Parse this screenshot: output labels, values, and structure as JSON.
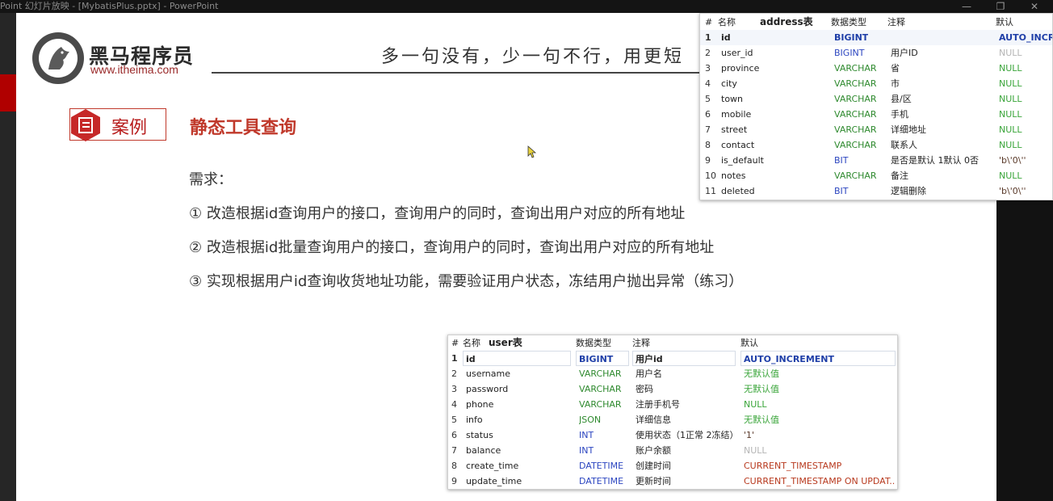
{
  "window": {
    "title": "Point 幻灯片放映 - [MybatisPlus.pptx] - PowerPoint",
    "buttons": [
      "—",
      "❐",
      "✕"
    ]
  },
  "slide": {
    "logo_text": "黑马程序员",
    "logo_url": "www.itheima.com",
    "slogan": "多一句没有，少一句不行，用更短",
    "case_label": "案例",
    "title": "静态工具查询",
    "requirements_title": "需求：",
    "requirements": [
      "①  改造根据id查询用户的接口，查询用户的同时，查询出用户对应的所有地址",
      "②  改造根据id批量查询用户的接口，查询用户的同时，查询出用户对应的所有地址",
      "③  实现根据用户id查询收货地址功能，需要验证用户状态，冻结用户抛出异常（练习）"
    ]
  },
  "address_table": {
    "table_name": "address表",
    "headers": [
      "#",
      "名称",
      "数据类型",
      "注释",
      "默认"
    ],
    "rows": [
      {
        "num": "1",
        "name": "id",
        "type": "BIGINT",
        "comment": "",
        "default": "AUTO_INCRE"
      },
      {
        "num": "2",
        "name": "user_id",
        "type": "BIGINT",
        "comment": "用户ID",
        "default": "NULL"
      },
      {
        "num": "3",
        "name": "province",
        "type": "VARCHAR",
        "comment": "省",
        "default": "NULL"
      },
      {
        "num": "4",
        "name": "city",
        "type": "VARCHAR",
        "comment": "市",
        "default": "NULL"
      },
      {
        "num": "5",
        "name": "town",
        "type": "VARCHAR",
        "comment": "县/区",
        "default": "NULL"
      },
      {
        "num": "6",
        "name": "mobile",
        "type": "VARCHAR",
        "comment": "手机",
        "default": "NULL"
      },
      {
        "num": "7",
        "name": "street",
        "type": "VARCHAR",
        "comment": "详细地址",
        "default": "NULL"
      },
      {
        "num": "8",
        "name": "contact",
        "type": "VARCHAR",
        "comment": "联系人",
        "default": "NULL"
      },
      {
        "num": "9",
        "name": "is_default",
        "type": "BIT",
        "comment": "是否是默认 1默认 0否",
        "default": "'b\\'0\\''"
      },
      {
        "num": "10",
        "name": "notes",
        "type": "VARCHAR",
        "comment": "备注",
        "default": "NULL"
      },
      {
        "num": "11",
        "name": "deleted",
        "type": "BIT",
        "comment": "逻辑删除",
        "default": "'b\\'0\\''"
      }
    ]
  },
  "user_table": {
    "table_name": "user表",
    "headers": [
      "#",
      "名称",
      "数据类型",
      "注释",
      "默认"
    ],
    "rows": [
      {
        "num": "1",
        "name": "id",
        "type": "BIGINT",
        "comment": "用户id",
        "default": "AUTO_INCREMENT"
      },
      {
        "num": "2",
        "name": "username",
        "type": "VARCHAR",
        "comment": "用户名",
        "default": "无默认值"
      },
      {
        "num": "3",
        "name": "password",
        "type": "VARCHAR",
        "comment": "密码",
        "default": "无默认值"
      },
      {
        "num": "4",
        "name": "phone",
        "type": "VARCHAR",
        "comment": "注册手机号",
        "default": "NULL"
      },
      {
        "num": "5",
        "name": "info",
        "type": "JSON",
        "comment": "详细信息",
        "default": "无默认值"
      },
      {
        "num": "6",
        "name": "status",
        "type": "INT",
        "comment": "使用状态（1正常 2冻结）",
        "default": "'1'"
      },
      {
        "num": "7",
        "name": "balance",
        "type": "INT",
        "comment": "账户余额",
        "default": "NULL"
      },
      {
        "num": "8",
        "name": "create_time",
        "type": "DATETIME",
        "comment": "创建时间",
        "default": "CURRENT_TIMESTAMP"
      },
      {
        "num": "9",
        "name": "update_time",
        "type": "DATETIME",
        "comment": "更新时间",
        "default": "CURRENT_TIMESTAMP ON UPDAT..."
      }
    ]
  },
  "colors": {
    "accent_red": "#c0392b",
    "type_blue": "#1f3fa8",
    "type_green": "#2f8a2f",
    "default_green": "#3aa53a",
    "null_gray": "#b5b5b5"
  }
}
